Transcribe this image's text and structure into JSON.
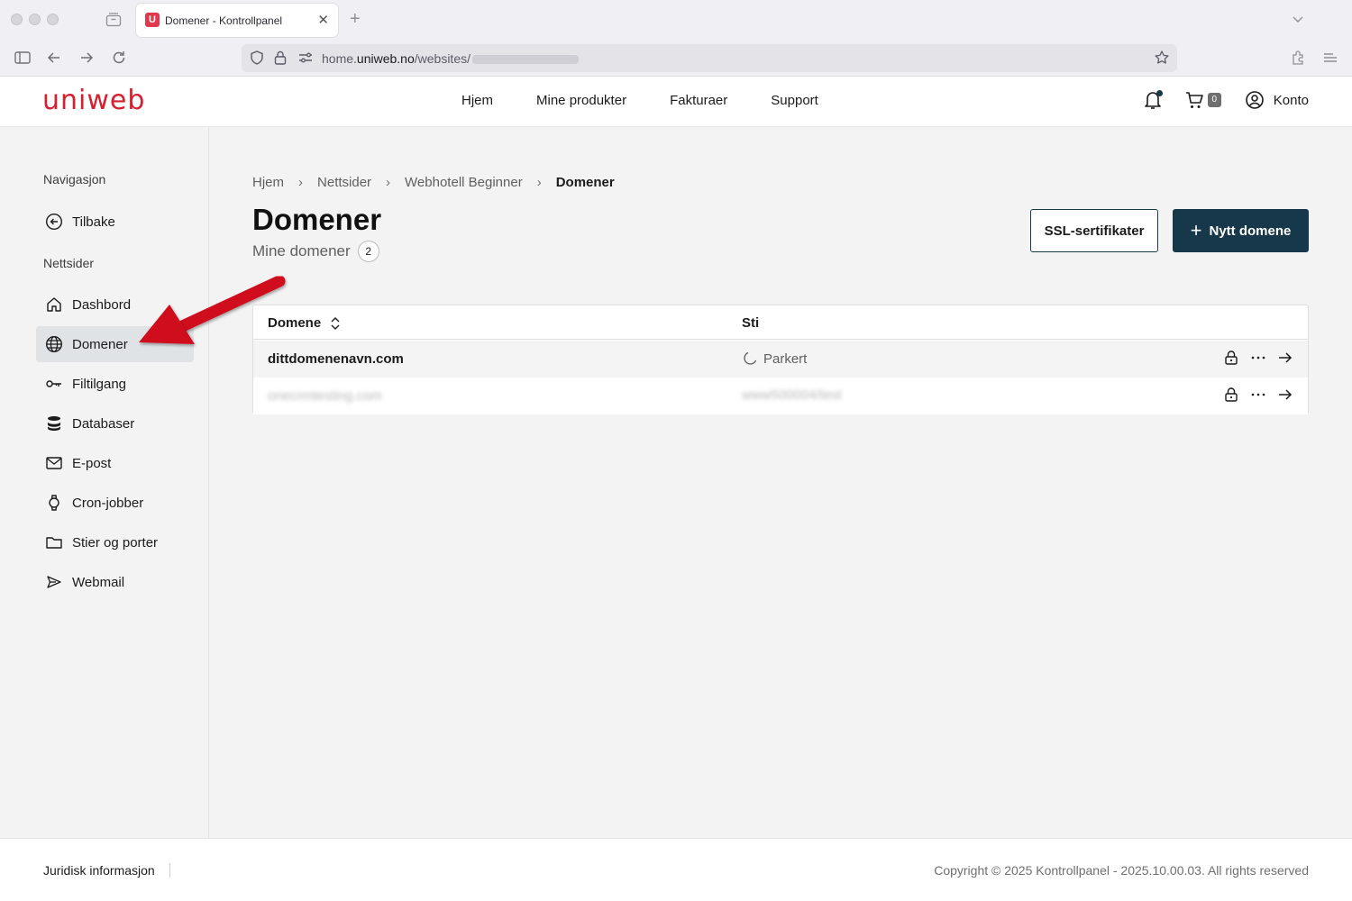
{
  "browser": {
    "tab_title": "Domener - Kontrollpanel",
    "tab_favicon": "U",
    "url_prefix": "home.",
    "url_host": "uniweb.no",
    "url_path": "/websites/"
  },
  "header": {
    "logo": "uniweb",
    "nav": [
      "Hjem",
      "Mine produkter",
      "Fakturaer",
      "Support"
    ],
    "cart_count": "0",
    "account_label": "Konto"
  },
  "sidebar": {
    "section_nav": "Navigasjon",
    "back_label": "Tilbake",
    "section_sites": "Nettsider",
    "items": [
      {
        "label": "Dashbord",
        "icon": "home-icon"
      },
      {
        "label": "Domener",
        "icon": "globe-icon"
      },
      {
        "label": "Filtilgang",
        "icon": "key-icon"
      },
      {
        "label": "Databaser",
        "icon": "database-icon"
      },
      {
        "label": "E-post",
        "icon": "mail-icon"
      },
      {
        "label": "Cron-jobber",
        "icon": "watch-icon"
      },
      {
        "label": "Stier og porter",
        "icon": "folder-icon"
      },
      {
        "label": "Webmail",
        "icon": "send-icon"
      }
    ],
    "active_item": "Domener"
  },
  "main": {
    "breadcrumb": [
      "Hjem",
      "Nettsider",
      "Webhotell Beginner",
      "Domener"
    ],
    "title": "Domener",
    "subtitle": "Mine domener",
    "count": "2",
    "ssl_button": "SSL-sertifikater",
    "new_button": "Nytt domene",
    "table": {
      "col_domain": "Domene",
      "col_path": "Sti",
      "rows": [
        {
          "domain": "dittdomenenavn.com",
          "path": "Parkert",
          "status_icon": "moon-icon"
        },
        {
          "domain": "onecrmtesting.com",
          "path": "www500004/test",
          "blurred": true
        }
      ]
    }
  },
  "footer": {
    "legal": "Juridisk informasjon",
    "copyright": "Copyright © 2025 Kontrollpanel - 2025.10.00.03. All rights reserved"
  },
  "colors": {
    "brand": "#d4202f",
    "primary": "#16384a",
    "annotation_arrow": "#d0101f"
  }
}
